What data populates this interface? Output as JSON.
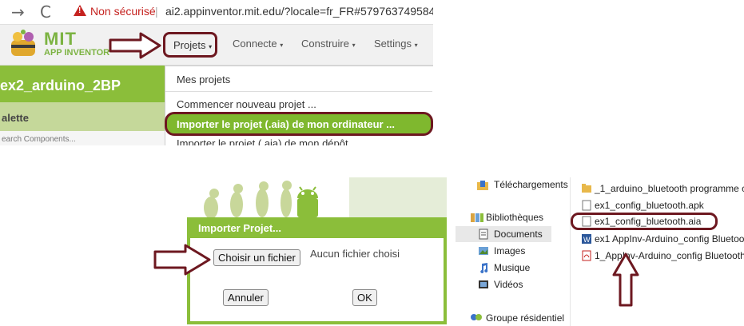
{
  "browser": {
    "back_glyph": "→",
    "refresh_glyph": "C",
    "security_warning": "Non sécurisé",
    "separator": "|",
    "url": "ai2.appinventor.mit.edu/?locale=fr_FR#579763749584"
  },
  "app_header": {
    "logo_main": "MIT",
    "logo_sub": "APP INVENTOR",
    "menu": [
      {
        "label": "Projets",
        "caret": "▾"
      },
      {
        "label": "Connecte",
        "caret": "▾"
      },
      {
        "label": "Construire",
        "caret": "▾"
      },
      {
        "label": "Settings",
        "caret": "▾"
      }
    ]
  },
  "project": {
    "title": "ex2_arduino_2BP",
    "palette_title": "alette",
    "search_placeholder": "earch Components..."
  },
  "projects_dropdown": {
    "items": [
      "Mes projets",
      "Commencer nouveau projet ...",
      "Importer le projet (.aia) de mon ordinateur ...",
      "Importer le projet (.aia) de mon dépôt"
    ]
  },
  "import_dialog": {
    "title": "Importer Projet...",
    "choose_file_button": "Choisir un fichier",
    "no_file_text": "Aucun fichier choisi",
    "cancel_button": "Annuler",
    "ok_button": "OK"
  },
  "explorer": {
    "nav": [
      "Téléchargements",
      "Bibliothèques",
      "Documents",
      "Images",
      "Musique",
      "Vidéos",
      "Groupe résidentiel"
    ],
    "files": [
      "_1_arduino_bluetooth programme c",
      "ex1_config_bluetooth.apk",
      "ex1_config_bluetooth.aia",
      "ex1 AppInv-Arduino_config Bluetoo",
      "1_AppInv-Arduino_config Bluetooth"
    ]
  },
  "colors": {
    "accent_green": "#8bbe3a",
    "annotation_maroon": "#6d1820",
    "warning_red": "#c5221f"
  }
}
